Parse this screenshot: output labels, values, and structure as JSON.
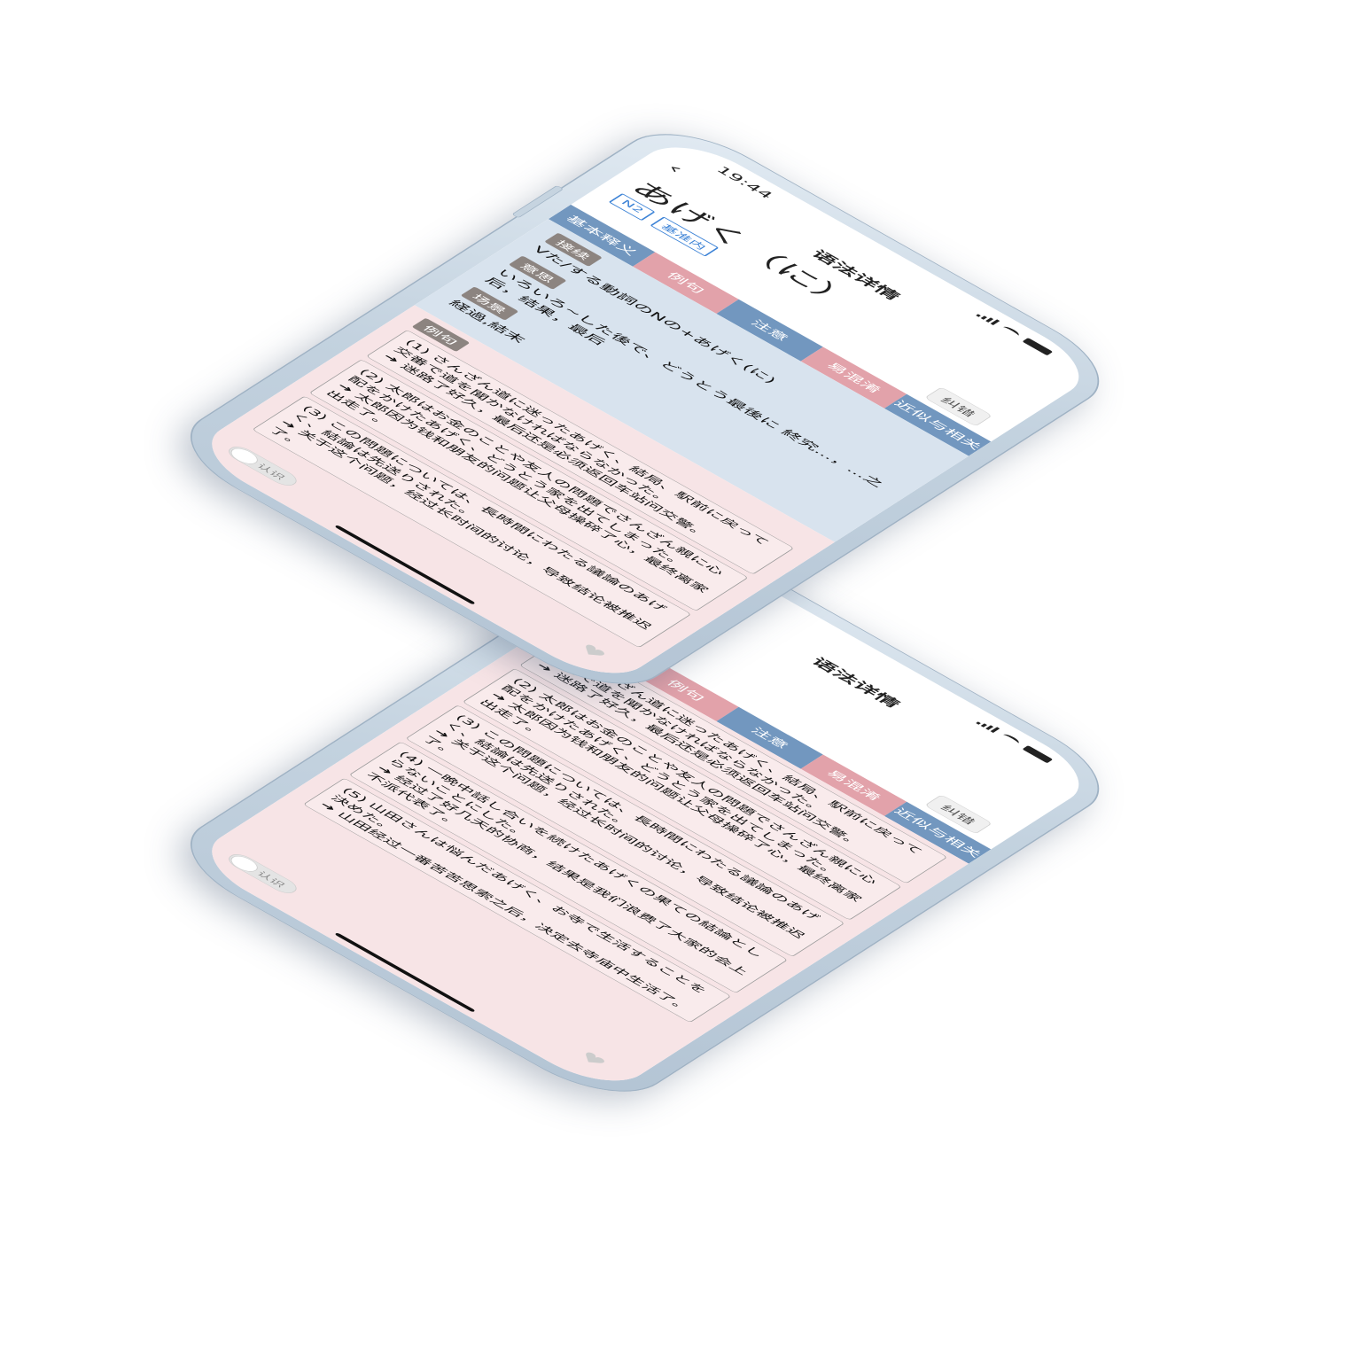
{
  "status": {
    "time": "19:44"
  },
  "nav": {
    "back": "‹",
    "title": "语法详情"
  },
  "grammar": {
    "title": "あげく（に）",
    "tags": [
      "N2",
      "基准内"
    ],
    "correct_label": "纠错"
  },
  "tabs": [
    "基本释义",
    "例句",
    "注意",
    "易混淆",
    "近似与相关"
  ],
  "basic": {
    "connection_label": "接续",
    "connection_text": "Vた/する動詞のNの+あげく(に)",
    "meaning_label": "意思",
    "meaning_text": "いろいろ~した後で、どうとう最後に 終究...，...之后，结果，最后",
    "scene_label": "场景",
    "scene_text": "経過,結末"
  },
  "examples": {
    "label": "例句",
    "items": [
      {
        "jp": "(1) さんざん道に迷ったあげく、結局、駅前に戻って交番で道を聞かなければならなかった。",
        "cn": "➜ 迷路了好久，最后还是必须返回车站问交警。"
      },
      {
        "jp": "(2) 太郎はお金のことや友人の問題でさんざん親に心配をかけたあげく、どうとう家を出てしまった。",
        "cn": "➜ 太郎因为钱和朋友的问题让父母操碎了心，最终离家出走了。"
      },
      {
        "jp": "(3) この問題については、長時間にわたる議論のあげく、結論は先送りされた。",
        "cn": "➜ 关于这个问题，经过长时间的讨论，导致结论被推迟了。"
      },
      {
        "jp": "(4) 一晩中話し合いを続けたあげくの果ての結論としらないことにした。",
        "cn": "➜ 经过了好几天的协商，结果是我们浪费了大家的会上不派代表了。"
      },
      {
        "jp": "(5) 山田さんは悩んだあげく、お寺で生活することを決めた。",
        "cn": "➜ 山田经过一番苦苦思索之后，决定去寺庙中生活了。"
      }
    ]
  },
  "footer": {
    "toggle_label": "认识"
  },
  "colors": {
    "basic_bg": "#d8e3ee",
    "examples_bg": "#f7e4e6",
    "tab_blue": "#7297bf",
    "tab_pink": "#e2a2aa"
  }
}
